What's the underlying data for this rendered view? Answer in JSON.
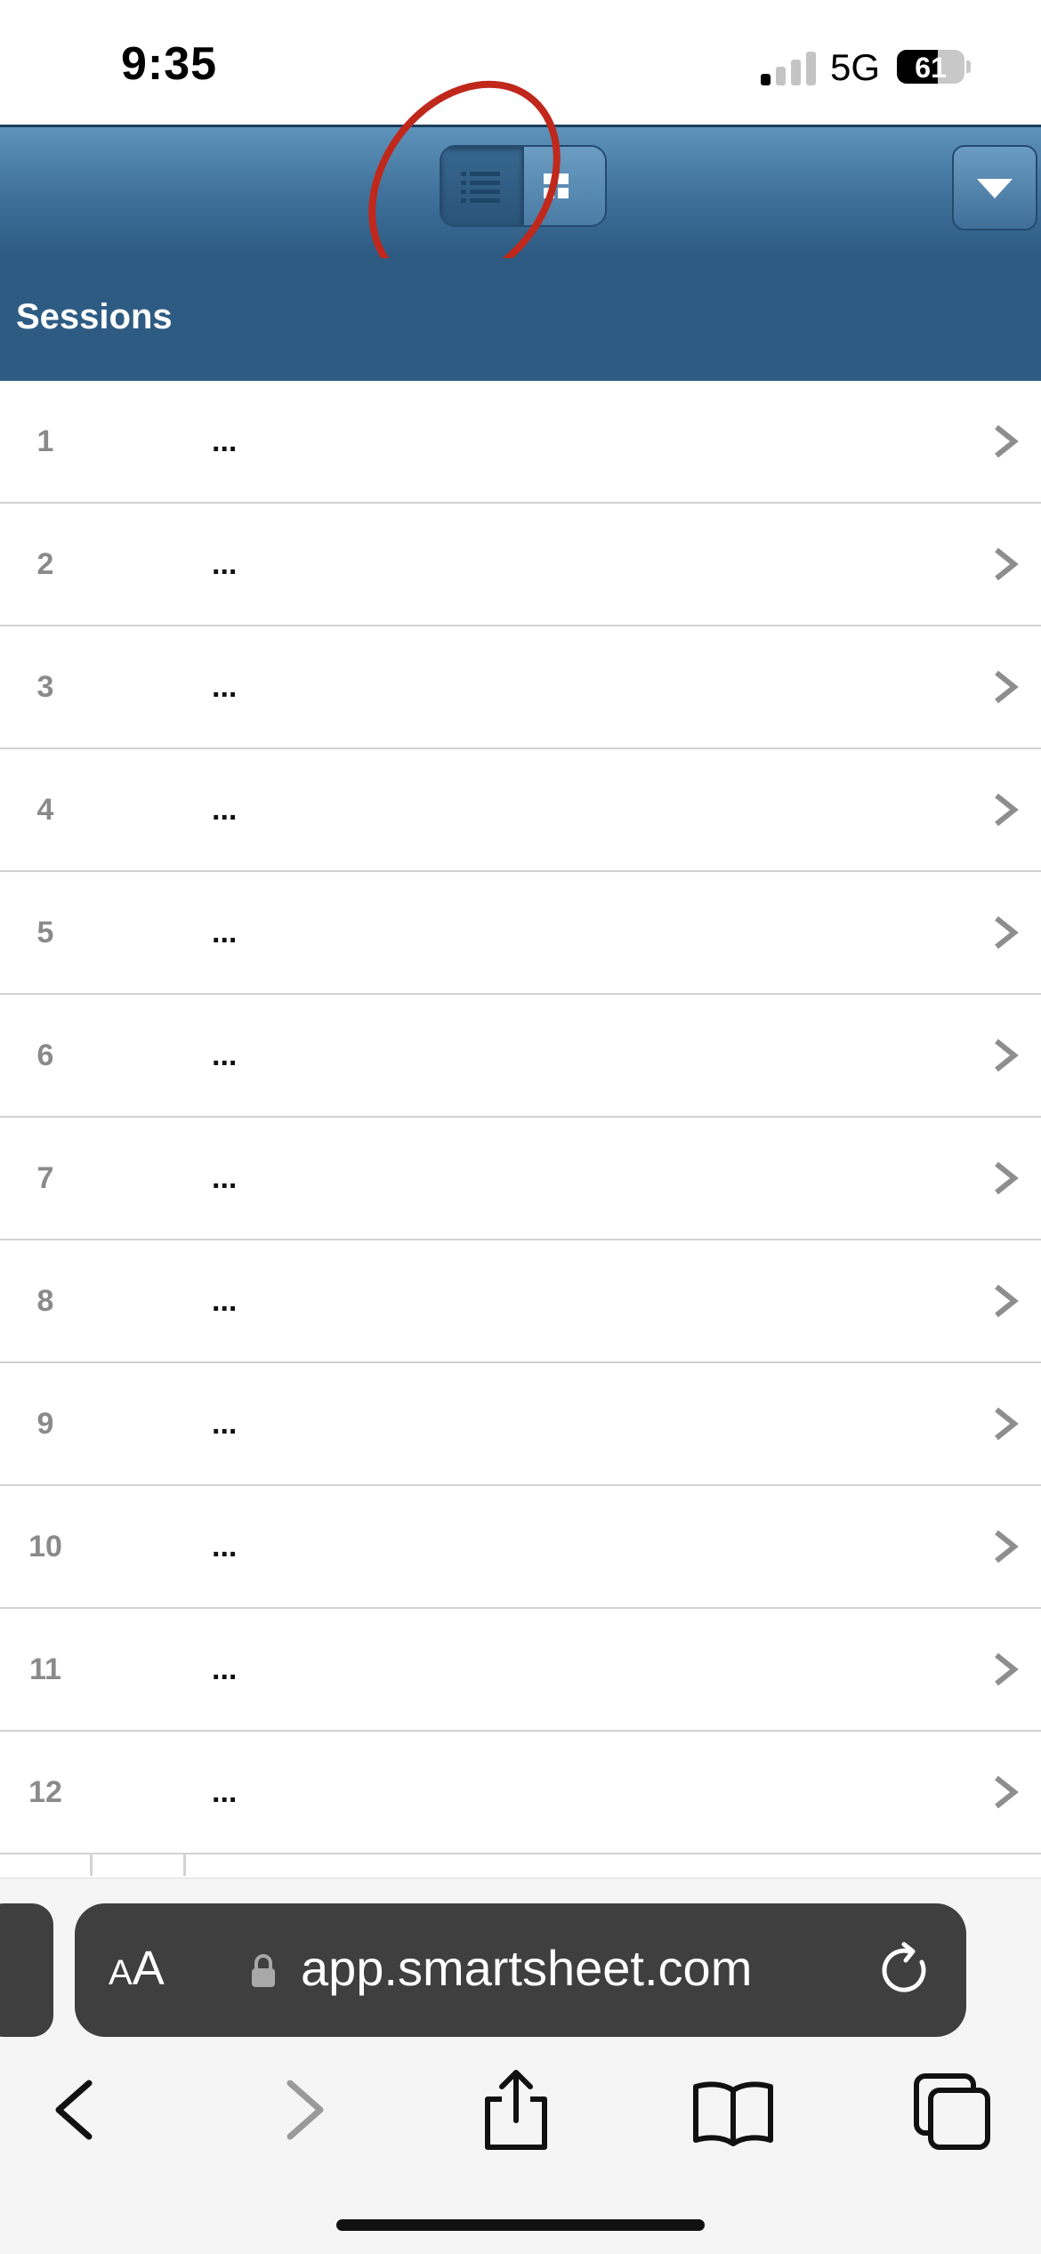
{
  "status_bar": {
    "time": "9:35",
    "network": "5G",
    "battery": "61",
    "signal_bars_active": 1,
    "signal_bars_total": 4
  },
  "header": {
    "view_toggle": {
      "list_icon": "list-view-icon",
      "grid_icon": "grid-view-icon",
      "selected": "list"
    },
    "dropdown_icon": "triangle-down-icon",
    "highlight": "red-ellipse-annotation"
  },
  "section": {
    "title": "Sessions"
  },
  "rows": [
    {
      "num": "1",
      "text": "..."
    },
    {
      "num": "2",
      "text": "..."
    },
    {
      "num": "3",
      "text": "..."
    },
    {
      "num": "4",
      "text": "..."
    },
    {
      "num": "5",
      "text": "..."
    },
    {
      "num": "6",
      "text": "..."
    },
    {
      "num": "7",
      "text": "..."
    },
    {
      "num": "8",
      "text": "..."
    },
    {
      "num": "9",
      "text": "..."
    },
    {
      "num": "10",
      "text": "..."
    },
    {
      "num": "11",
      "text": "..."
    },
    {
      "num": "12",
      "text": "..."
    }
  ],
  "browser": {
    "text_size_label_small": "A",
    "text_size_label_large": "A",
    "url": "app.smartsheet.com",
    "icons": [
      "back-icon",
      "forward-icon",
      "share-icon",
      "bookmarks-icon",
      "tabs-icon"
    ]
  },
  "colors": {
    "header_top": "#5e93bb",
    "header_bottom": "#2d5a82",
    "section_bg": "#2e5b82",
    "annotation": "#c0281c"
  }
}
